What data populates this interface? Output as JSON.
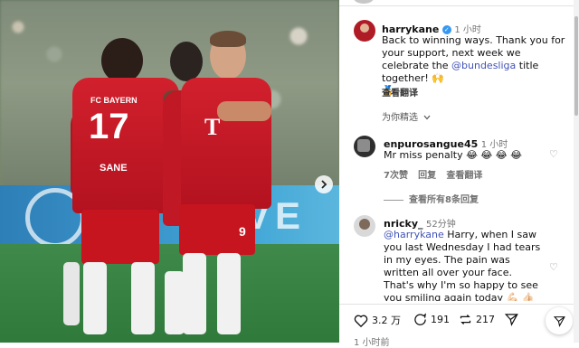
{
  "post": {
    "author": "harrykane",
    "time": "1 小时",
    "caption_part1": "Back to winning ways. Thank you for your support, next week we celebrate the ",
    "caption_mention": "@bundesliga",
    "caption_part2": " title together! 🙌",
    "caption_emoji2": "🏅",
    "translate": "查看翻译",
    "selected_by": "为你精选",
    "photo": {
      "player1_number": "17",
      "player1_team": "FC BAYERN",
      "player1_name": "SANE",
      "player2_number": "9",
      "board_text": "VE",
      "club_logo": "T"
    }
  },
  "comments": [
    {
      "user": "enpurosangue45",
      "time": "1 小时",
      "text": "Mr miss penalty 😂 😂 😂 😂",
      "likes": "7次赞",
      "reply": "回复",
      "translate": "查看翻译",
      "view_replies": "查看所有8条回复"
    },
    {
      "user": "nricky_",
      "time": "52分钟",
      "mention": "@harrykane",
      "text": " Harry, when I saw you last Wednesday I had tears in my eyes. The pain was written all over your face. That's why I'm so happy to see you smiling again today 💪🏻 👍🏻 😊"
    }
  ],
  "actions": {
    "likes": "3.2 万",
    "comments": "191",
    "reposts": "217"
  },
  "footer_time": "1 小时前",
  "colors": {
    "kit_red": "#d2202d",
    "link_blue": "#4153b8",
    "verified_blue": "#3797f0"
  }
}
